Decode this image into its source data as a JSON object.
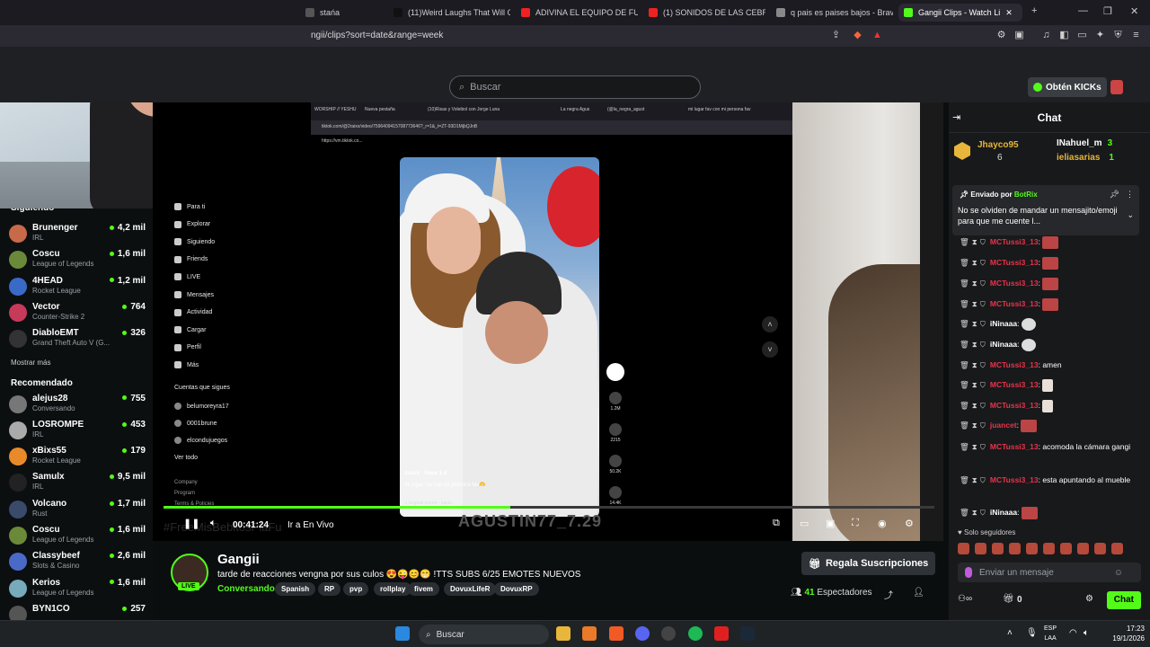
{
  "browser": {
    "tabs": [
      {
        "label": "stańa",
        "color": "#555"
      },
      {
        "label": "(11)Weird Laughs That Will Ge",
        "color": "#111"
      },
      {
        "label": "ADIVINA EL EQUIPO DE FUTBO",
        "color": "#e22"
      },
      {
        "label": "(1) SONIDOS DE LAS CEBRAS",
        "color": "#e22"
      },
      {
        "label": "q pais es paises bajos - Brave S",
        "color": "#888"
      },
      {
        "label": "Gangii Clips - Watch Li",
        "color": "#53fc18"
      }
    ],
    "new_tab": "+",
    "url": "ngii/clips?sort=date&range=week"
  },
  "kick": {
    "search_placeholder": "Buscar",
    "get_kicks_label": "Obtén KICKs"
  },
  "sidebar": {
    "following_title": "Siguiendo",
    "following": [
      {
        "name": "Brunenger",
        "category": "IRL",
        "viewers": "4,2 mil",
        "color": "#c86a4a"
      },
      {
        "name": "Coscu",
        "category": "League of Legends",
        "viewers": "1,6 mil",
        "color": "#6a8a3a"
      },
      {
        "name": "4HEAD",
        "category": "Rocket League",
        "viewers": "1,2 mil",
        "color": "#3a6ac8"
      },
      {
        "name": "Vector",
        "category": "Counter-Strike 2",
        "viewers": "764",
        "color": "#c83a5a"
      },
      {
        "name": "DiabloEMT",
        "category": "Grand Theft Auto V (G...",
        "viewers": "326",
        "color": "#333"
      }
    ],
    "show_more": "Mostrar más",
    "recommended_title": "Recomendado",
    "recommended": [
      {
        "name": "alejus28",
        "category": "Conversando",
        "viewers": "755",
        "color": "#777"
      },
      {
        "name": "LOSROMPE",
        "category": "IRL",
        "viewers": "453",
        "color": "#aaa"
      },
      {
        "name": "xBixs55",
        "category": "Rocket League",
        "viewers": "179",
        "color": "#e88a2a"
      },
      {
        "name": "Samulx",
        "category": "IRL",
        "viewers": "9,5 mil",
        "color": "#222"
      },
      {
        "name": "Volcano",
        "category": "Rust",
        "viewers": "1,7 mil",
        "color": "#3a4a6a"
      },
      {
        "name": "Coscu",
        "category": "League of Legends",
        "viewers": "1,6 mil",
        "color": "#6a8a3a"
      },
      {
        "name": "Classybeef",
        "category": "Slots & Casino",
        "viewers": "2,6 mil",
        "color": "#4a6ac8"
      },
      {
        "name": "Kerios",
        "category": "League of Legends",
        "viewers": "1,6 mil",
        "color": "#7ab"
      },
      {
        "name": "BYN1CO",
        "category": "",
        "viewers": "257",
        "color": "#555"
      }
    ]
  },
  "video": {
    "inner_tabs": [
      "WORSHIP // YESHU",
      "Nueva pestaña",
      "(10)Risas y Voleibol con Jorge Luna",
      "La negra Agus",
      "(@la_negra_agust",
      "mi lugar fav con mi persona fav"
    ],
    "inner_url": "tiktok.com/@2raixx/video/7596409415708773646?_r=1&_t=ZT-93D1MjbQJnB",
    "inner_url2": "https://vm.tiktok.co...",
    "tiktok_nav": [
      "Para ti",
      "Explorar",
      "Siguiendo",
      "Friends",
      "LIVE",
      "Mensajes",
      "Actividad",
      "Cargar",
      "Perfil",
      "Más"
    ],
    "following_accounts_title": "Cuentas que sigues",
    "following_accounts": [
      "belumoreyra17",
      "0001brune",
      "elcondujuegos"
    ],
    "see_all": "Ver todo",
    "footer_links": [
      "Company",
      "Program",
      "Terms & Policies"
    ],
    "tiktok_user": "2raixx · Hace 1 d",
    "tiktok_caption": "mi lugar fav con mi persona fav🫶",
    "tiktok_sound": "♫ original sound - paula",
    "tiktok_counts": [
      "1.2M",
      "2215",
      "50.2K",
      "14.4K"
    ],
    "overlay_name": "AGUSTIN77_7.29",
    "overlay_hashtag": "#FreeMisBebitosPlaFu",
    "progress": 0.45,
    "time": "00:41:24",
    "live_label": "Ir a En Vivo"
  },
  "stream": {
    "streamer": "Gangii",
    "title": "tarde de reacciones vengna por sus culos 😍😜😊😁 !TTS  SUBS 6/25 EMOTES NUEVOS",
    "category": "Conversando",
    "tags": [
      "Spanish",
      "RP",
      "pvp",
      "rollplay",
      "fivem",
      "DovuxLifeR",
      "DovuxRP"
    ],
    "live_badge": "LIVE",
    "gift_subs_label": "Regala Suscripciones",
    "viewers": "41",
    "viewers_label": "Espectadores"
  },
  "chat": {
    "title": "Chat",
    "gifters": [
      {
        "name": "Jhayco95",
        "count": "6",
        "color": "#e8b63a"
      },
      {
        "name": "INahuel_m",
        "count": "3",
        "color": "#fff"
      },
      {
        "name": "ieliasarias",
        "count": "1",
        "color": "#e8b63a"
      }
    ],
    "pinned_by_prefix": "Enviado por",
    "pinned_by": "BotRix",
    "pinned_message": "No se olviden de mandar un mensajito/emoji para que me cuente l...",
    "messages": [
      {
        "user": "MCTussi3_13",
        "text": "",
        "emote": "red",
        "color": "#e8334a"
      },
      {
        "user": "MCTussi3_13",
        "text": "",
        "emote": "red",
        "color": "#e8334a"
      },
      {
        "user": "MCTussi3_13",
        "text": "",
        "emote": "red",
        "color": "#e8334a"
      },
      {
        "user": "MCTussi3_13",
        "text": "",
        "emote": "red",
        "color": "#e8334a"
      },
      {
        "user": "iNinaaa",
        "text": "",
        "emote": "bird",
        "color": "#fff"
      },
      {
        "user": "iNinaaa",
        "text": "",
        "emote": "bird",
        "color": "#fff"
      },
      {
        "user": "MCTussi3_13",
        "text": "amen",
        "emote": "",
        "color": "#e8334a"
      },
      {
        "user": "MCTussi3_13",
        "text": "",
        "emote": "feet",
        "color": "#e8334a"
      },
      {
        "user": "MCTussi3_13",
        "text": "",
        "emote": "feet",
        "color": "#e8334a"
      },
      {
        "user": "juancet",
        "text": "",
        "emote": "red",
        "color": "#e8334a"
      },
      {
        "user": "MCTussi3_13",
        "text": "acomoda la cámara gangi",
        "emote": "",
        "color": "#e8334a"
      },
      {
        "user": "MCTussi3_13",
        "text": "esta apuntando al mueble",
        "emote": "",
        "color": "#e8334a"
      },
      {
        "user": "iNinaaa",
        "text": "",
        "emote": "red",
        "color": "#fff"
      }
    ],
    "followers_only": "Solo seguidores",
    "input_placeholder": "Enviar un mensaje",
    "points": "0",
    "send_label": "Chat"
  },
  "taskbar": {
    "search_placeholder": "Buscar",
    "lang": "ESP",
    "lang2": "LAA",
    "time": "17:23",
    "date": "19/1/2026"
  }
}
